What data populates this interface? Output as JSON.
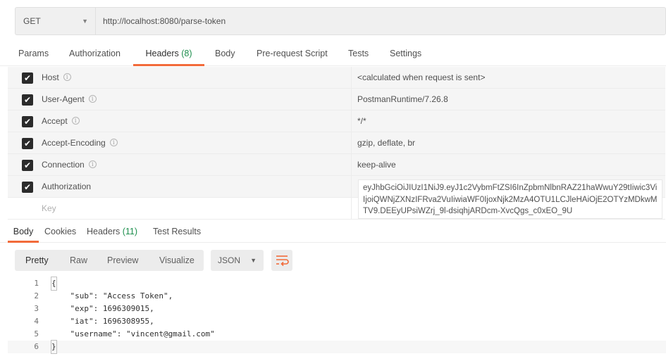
{
  "request": {
    "method": "GET",
    "url": "http://localhost:8080/parse-token"
  },
  "request_tabs": [
    {
      "label": "Params"
    },
    {
      "label": "Authorization"
    },
    {
      "label": "Headers",
      "count": "(8)"
    },
    {
      "label": "Body"
    },
    {
      "label": "Pre-request Script"
    },
    {
      "label": "Tests"
    },
    {
      "label": "Settings"
    }
  ],
  "headers": [
    {
      "key": "Host",
      "value": "<calculated when request is sent>",
      "checked": true
    },
    {
      "key": "User-Agent",
      "value": "PostmanRuntime/7.26.8",
      "checked": true
    },
    {
      "key": "Accept",
      "value": "*/*",
      "checked": true
    },
    {
      "key": "Accept-Encoding",
      "value": "gzip, deflate, br",
      "checked": true
    },
    {
      "key": "Connection",
      "value": "keep-alive",
      "checked": true
    },
    {
      "key": "Authorization",
      "value": "eyJhbGciOiJIUzI1NiJ9.eyJ1c2VybmFtZSI6InZpbmNlbnRAZ21haWwuY29tIiwic3ViIjoiQWNjZXNzIFRva2VuIiwiaWF0IjoxNjk2MzA4OTU1LCJleHAiOjE2OTYzMDkwMTV9.DEEyUPsiWZrj_9l-dsiqhjARDcm-XvcQgs_c0xEO_9U",
      "checked": true
    }
  ],
  "new_header_placeholder": "Key",
  "response_tabs": [
    {
      "label": "Body"
    },
    {
      "label": "Cookies"
    },
    {
      "label": "Headers",
      "count": "(11)"
    },
    {
      "label": "Test Results"
    }
  ],
  "view_modes": [
    "Pretty",
    "Raw",
    "Preview",
    "Visualize"
  ],
  "format": "JSON",
  "icons": {
    "wrap": "wrap-lines-icon",
    "info": "info-icon",
    "check": "checkbox-icon",
    "caret": "chevron-down-icon"
  },
  "response_lines": [
    {
      "num": "1",
      "text": "{"
    },
    {
      "num": "2",
      "text": "    \"sub\": \"Access Token\","
    },
    {
      "num": "3",
      "text": "    \"exp\": 1696309015,"
    },
    {
      "num": "4",
      "text": "    \"iat\": 1696308955,"
    },
    {
      "num": "5",
      "text": "    \"username\": \"vincent@gmail.com\""
    },
    {
      "num": "6",
      "text": "}"
    }
  ],
  "colors": {
    "accent": "#f26b3a",
    "count": "#1e8f4e"
  }
}
